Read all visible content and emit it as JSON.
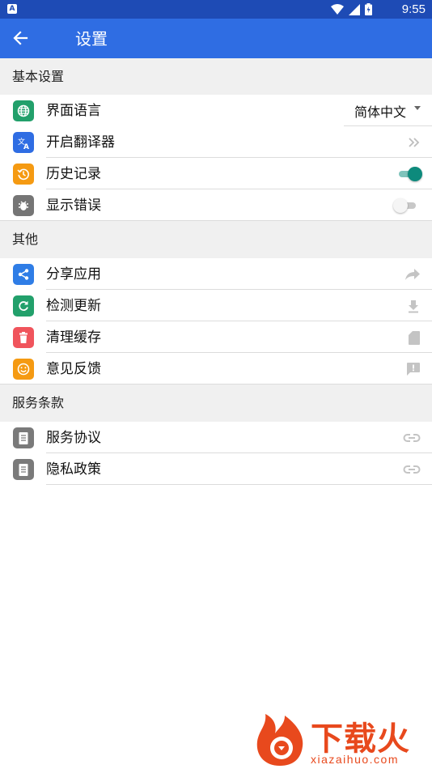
{
  "status_bar": {
    "time": "9:55",
    "notification_icon": "a-notification-icon",
    "icons": [
      "wifi-icon",
      "signal-icon",
      "battery-icon"
    ]
  },
  "app_bar": {
    "title": "设置",
    "back_icon": "arrow-back-icon"
  },
  "sections": {
    "basic": {
      "title": "基本设置",
      "items": {
        "language": {
          "label": "界面语言",
          "value": "简体中文",
          "icon": "globe-icon",
          "icon_color": "#22a06b"
        },
        "translator": {
          "label": "开启翻译器",
          "icon": "translate-icon",
          "icon_color": "#2f6de3"
        },
        "history": {
          "label": "历史记录",
          "icon": "history-icon",
          "icon_color": "#f59a12",
          "toggle": true
        },
        "errors": {
          "label": "显示错误",
          "icon": "bug-icon",
          "icon_color": "#757575",
          "toggle": false
        }
      }
    },
    "other": {
      "title": "其他",
      "items": {
        "share": {
          "label": "分享应用",
          "icon": "share-icon",
          "icon_color": "#2f7de6"
        },
        "update": {
          "label": "检测更新",
          "icon": "refresh-icon",
          "icon_color": "#22a06b"
        },
        "cache": {
          "label": "清理缓存",
          "icon": "trash-icon",
          "icon_color": "#f0545c"
        },
        "feedback": {
          "label": "意见反馈",
          "icon": "smile-icon",
          "icon_color": "#f59a12"
        }
      }
    },
    "terms": {
      "title": "服务条款",
      "items": {
        "agreement": {
          "label": "服务协议",
          "icon": "document-icon",
          "icon_color": "#7a7a7a"
        },
        "privacy": {
          "label": "隐私政策",
          "icon": "document-icon",
          "icon_color": "#7a7a7a"
        }
      }
    }
  },
  "watermark": {
    "brand": "下载火",
    "domain": "xiazaihuo.com"
  },
  "colors": {
    "status_bar": "#1e4bb5",
    "app_bar": "#2f6de3",
    "section_bg": "#f0f0f0",
    "toggle_on": "#0d8a7c",
    "trailing_icon": "#bdbdbd",
    "watermark": "#e8491d"
  }
}
